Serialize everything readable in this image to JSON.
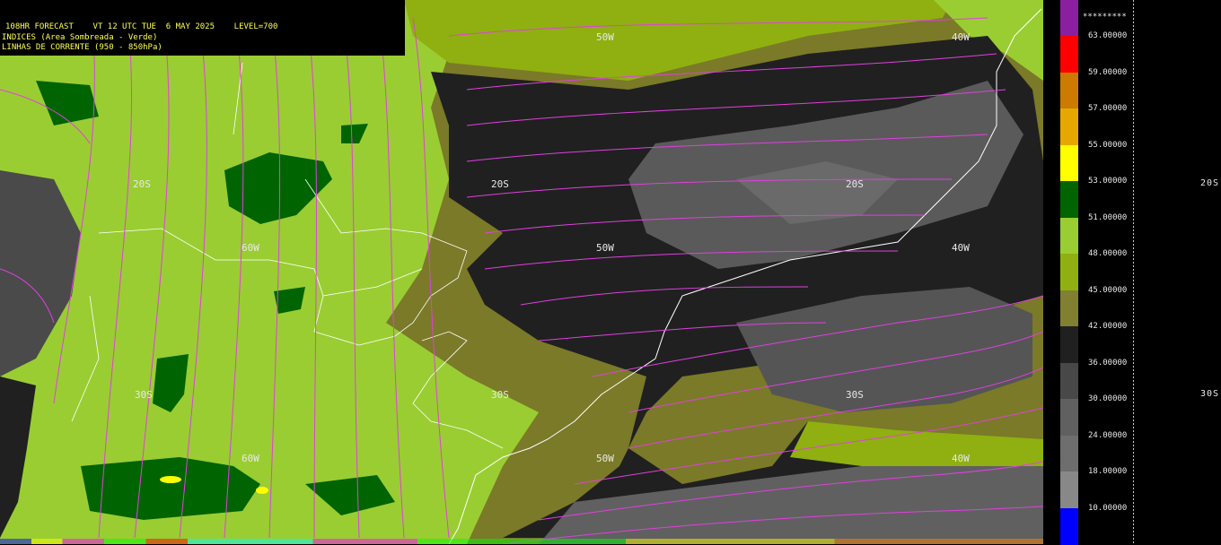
{
  "header": {
    "line1": "108HR FORECAST    VT 12 UTC TUE  6 MAY 2025    LEVEL=700",
    "line2": "INDICES (Area Sombreada - Verde)",
    "line3": "LINHAS DE CORRENTE (950 - 850hPa)"
  },
  "map_labels": {
    "lat_20s": "20S",
    "lat_30s": "30S",
    "lon_60w": "60W",
    "lon_50w": "50W",
    "lon_40w": "40W"
  },
  "legend": {
    "overflow": "*********",
    "ticks": [
      "63.00000",
      "59.00000",
      "57.00000",
      "55.00000",
      "53.00000",
      "51.00000",
      "48.00000",
      "45.00000",
      "42.00000",
      "36.00000",
      "30.00000",
      "24.00000",
      "18.00000",
      "10.00000"
    ],
    "colors": [
      "#8b1fa0",
      "#ff0000",
      "#cc7a00",
      "#e6a800",
      "#ffff00",
      "#006400",
      "#9acd32",
      "#8fb010",
      "#808030",
      "#202020",
      "#484848",
      "#606060",
      "#6e6e6e",
      "#888888",
      "#0000ff"
    ]
  },
  "edge_labels": {
    "right_20s": "20S",
    "right_30s": "30S"
  }
}
